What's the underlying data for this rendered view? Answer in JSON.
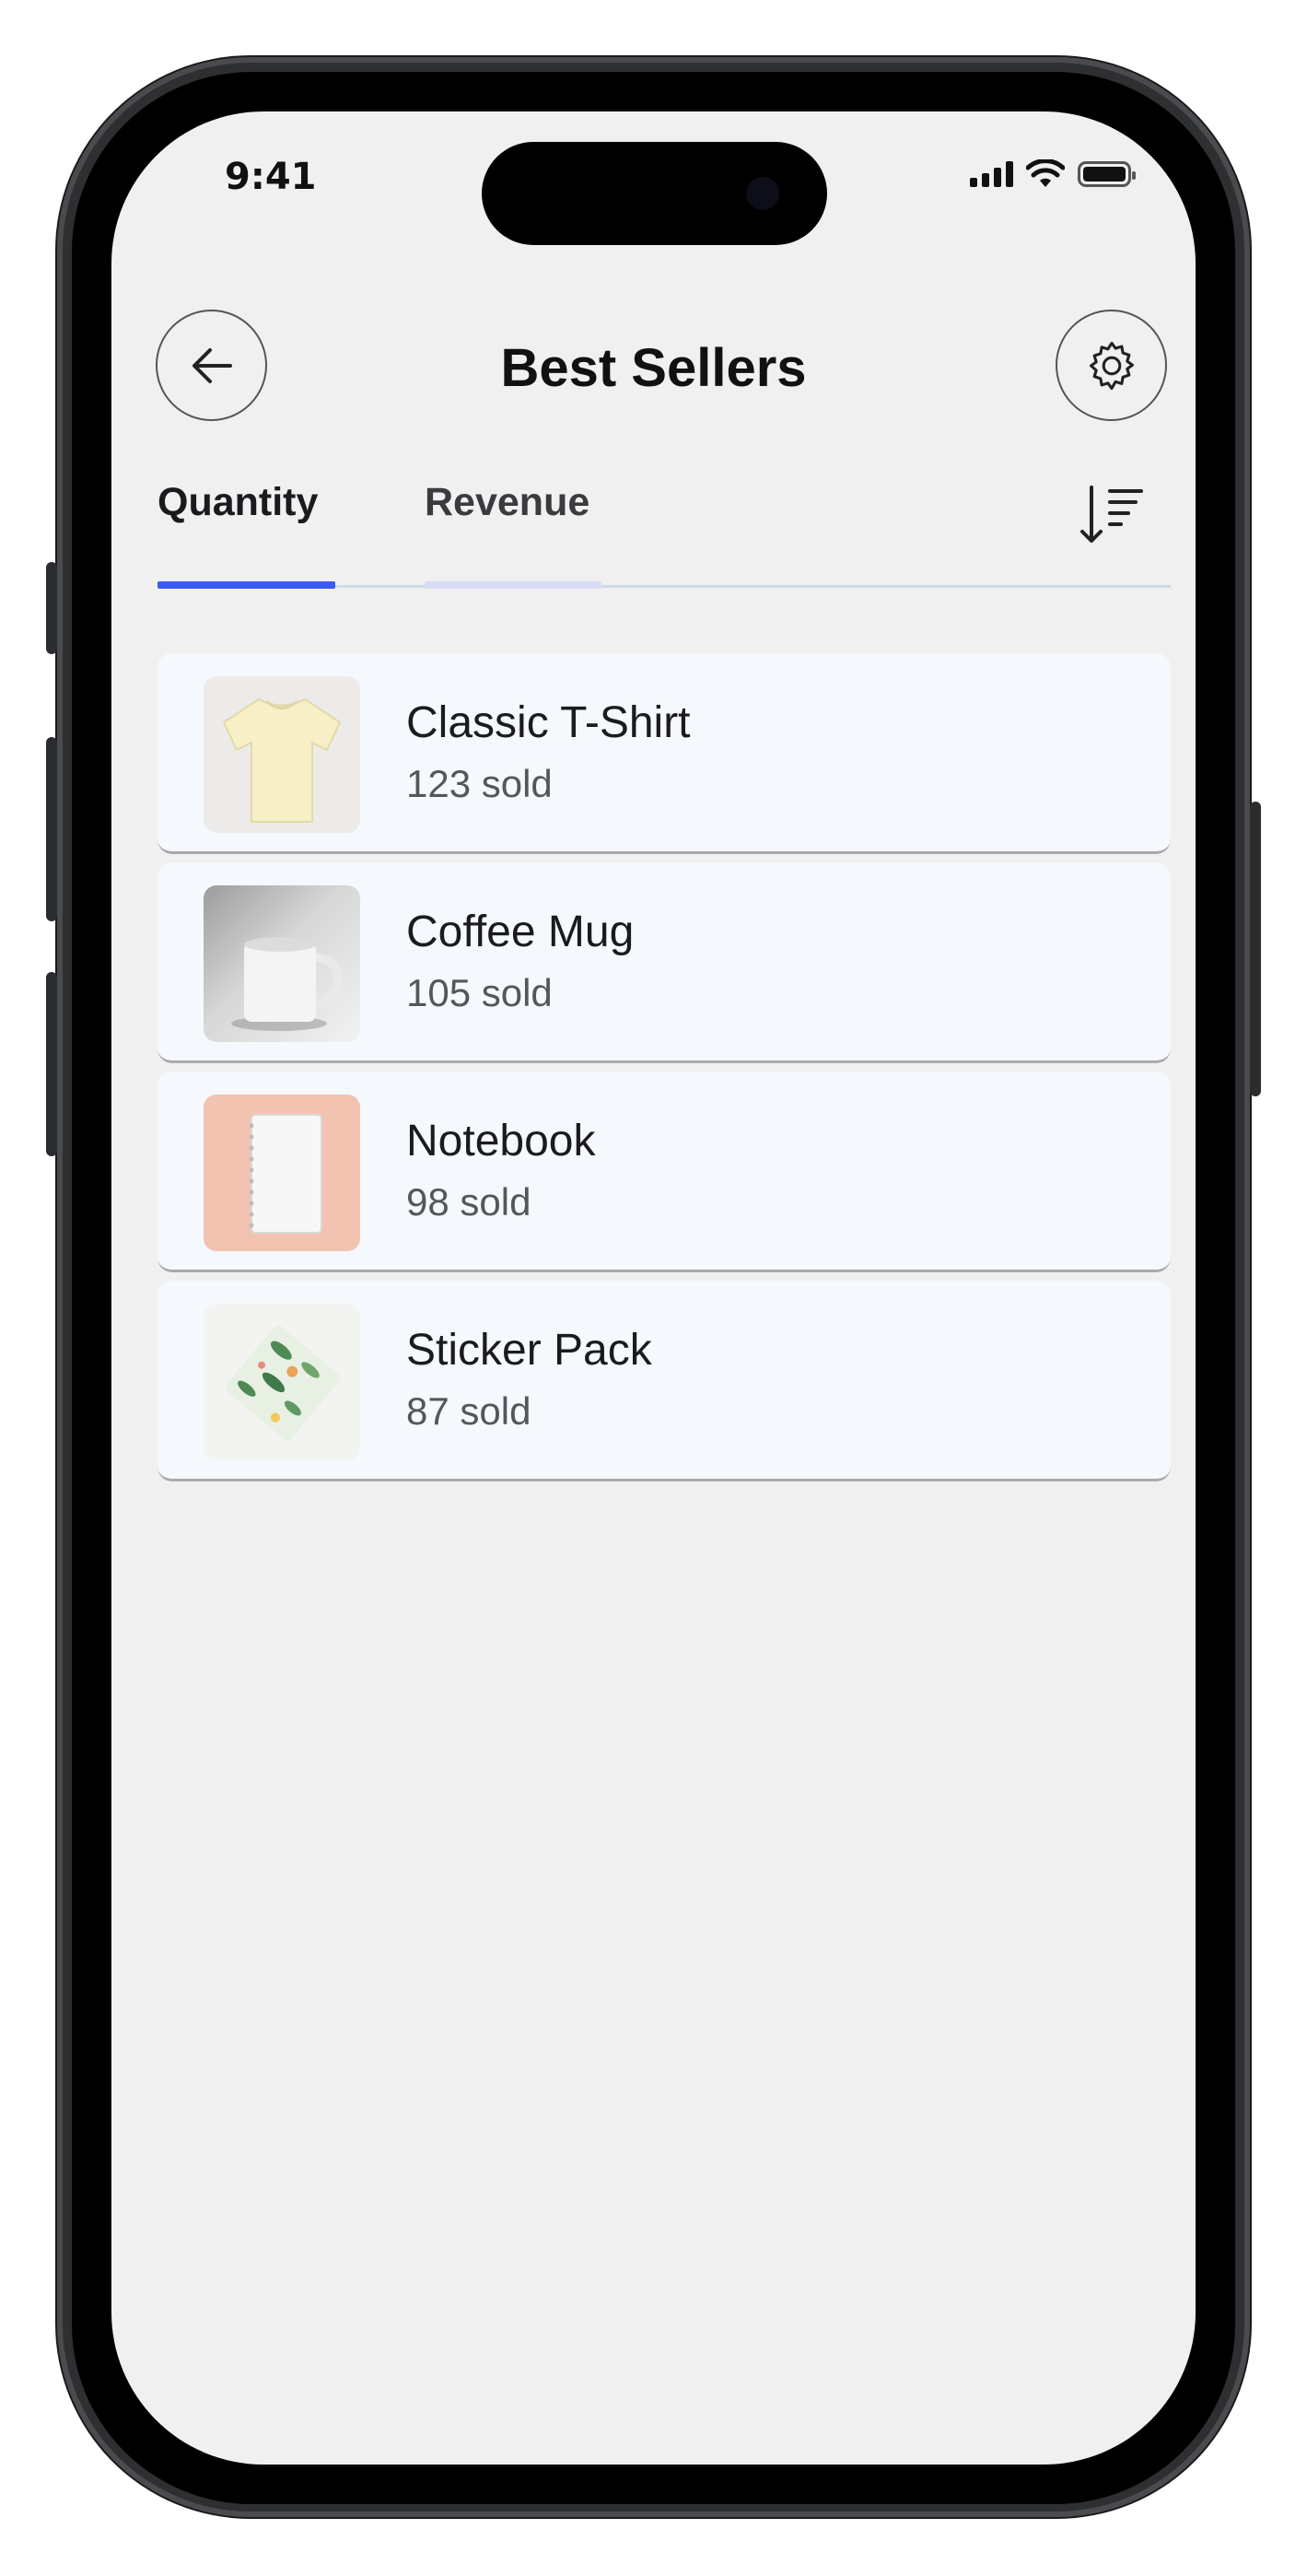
{
  "status": {
    "time": "9:41"
  },
  "header": {
    "title": "Best Sellers",
    "back_icon": "arrow-left-icon",
    "settings_icon": "gear-icon"
  },
  "tabs": [
    {
      "label": "Quantity",
      "active": true
    },
    {
      "label": "Revenue",
      "active": false
    }
  ],
  "sort_icon": "sort-descending-icon",
  "colors": {
    "accent": "#3b5bf0",
    "inactive_underline": "#d7dcf5",
    "card_bg": "#f5f8fc",
    "screen_bg": "#f0f0f0"
  },
  "items": [
    {
      "name": "Classic T-Shirt",
      "sold": "123 sold",
      "thumb": "tshirt-image"
    },
    {
      "name": "Coffee Mug",
      "sold": "105 sold",
      "thumb": "mug-image"
    },
    {
      "name": "Notebook",
      "sold": "98 sold",
      "thumb": "notebook-image"
    },
    {
      "name": "Sticker Pack",
      "sold": "87 sold",
      "thumb": "sticker-pack-image"
    }
  ]
}
